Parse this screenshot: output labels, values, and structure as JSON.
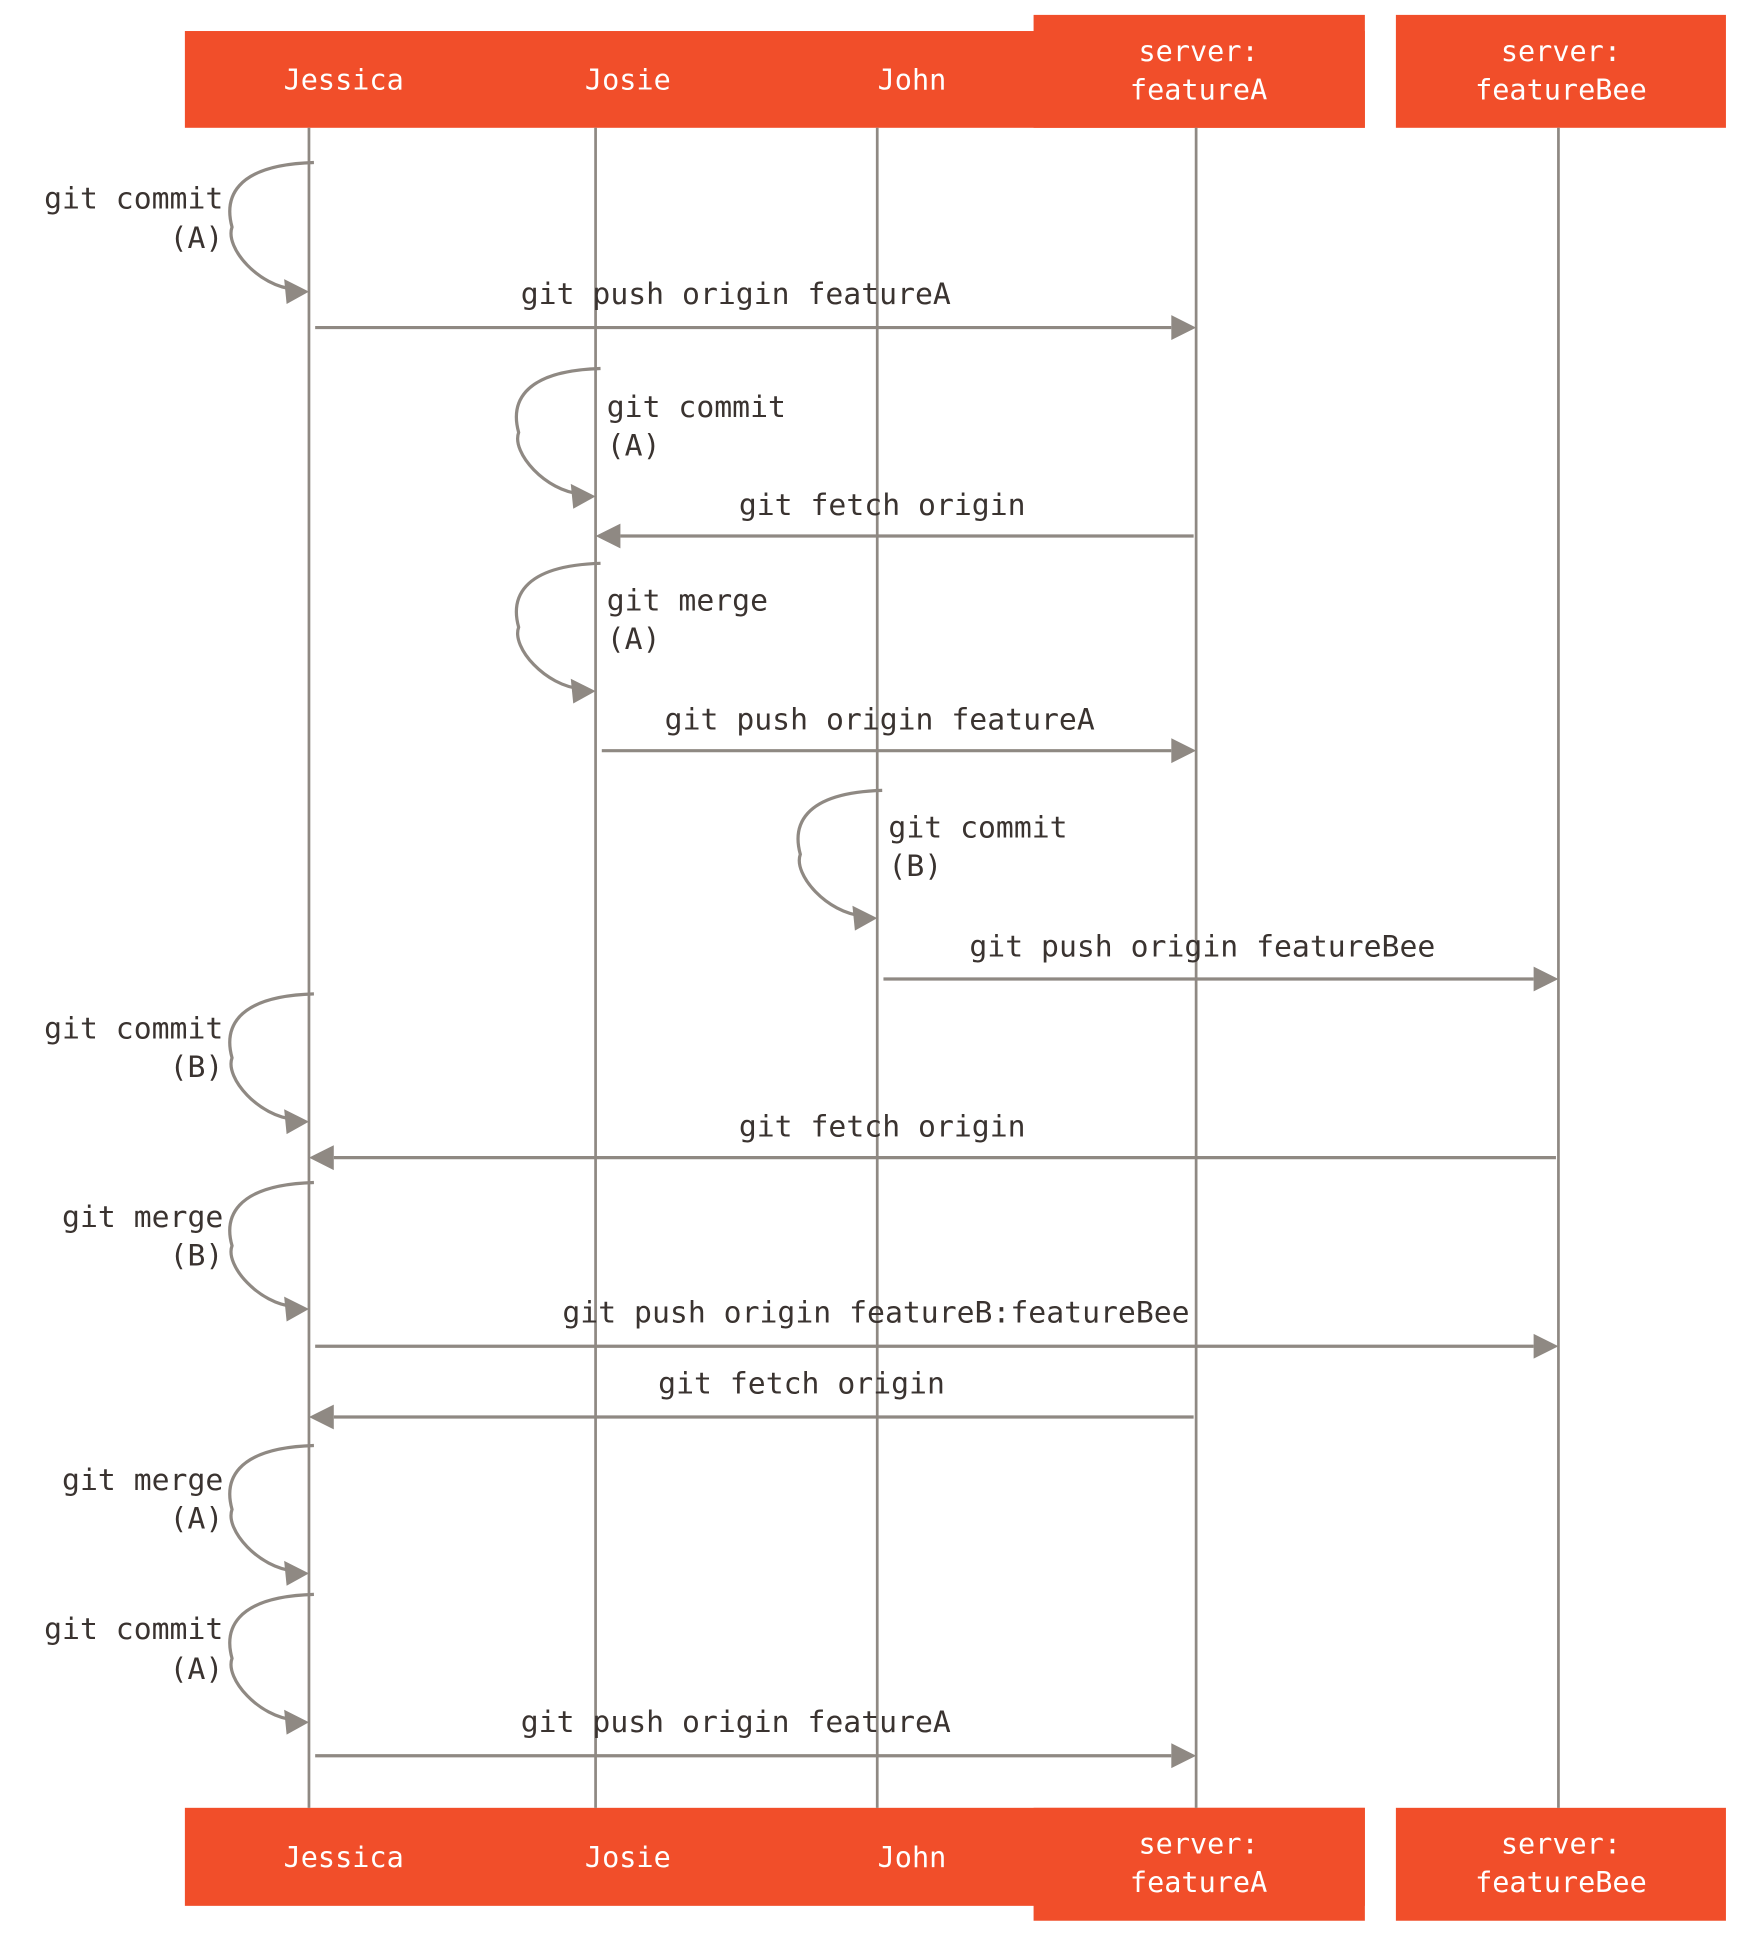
{
  "participants": [
    {
      "id": "jessica",
      "label": [
        "Jessica"
      ]
    },
    {
      "id": "josie",
      "label": [
        "Josie"
      ]
    },
    {
      "id": "john",
      "label": [
        "John"
      ]
    },
    {
      "id": "featureA",
      "label": [
        "server:",
        "featureA"
      ]
    },
    {
      "id": "featureBee",
      "label": [
        "server:",
        "featureBee"
      ]
    }
  ],
  "colors": {
    "accent": "#f14e2a",
    "line": "#8f8983",
    "text": "#3a3330"
  },
  "steps": [
    {
      "type": "self",
      "actor": "jessica",
      "label": [
        "git commit",
        "(A)"
      ]
    },
    {
      "type": "message",
      "from": "jessica",
      "to": "featureA",
      "label": "git push origin featureA"
    },
    {
      "type": "self",
      "actor": "josie",
      "label": [
        "git commit",
        "(A)"
      ]
    },
    {
      "type": "message",
      "from": "featureA",
      "to": "josie",
      "label": "git fetch origin"
    },
    {
      "type": "self",
      "actor": "josie",
      "label": [
        "git merge",
        "(A)"
      ]
    },
    {
      "type": "message",
      "from": "josie",
      "to": "featureA",
      "label": "git push origin featureA"
    },
    {
      "type": "self",
      "actor": "john",
      "label": [
        "git commit",
        "(B)"
      ]
    },
    {
      "type": "message",
      "from": "john",
      "to": "featureBee",
      "label": "git push origin featureBee"
    },
    {
      "type": "self",
      "actor": "jessica",
      "label": [
        "git commit",
        "(B)"
      ]
    },
    {
      "type": "message",
      "from": "featureBee",
      "to": "jessica",
      "label": "git fetch origin"
    },
    {
      "type": "self",
      "actor": "jessica",
      "label": [
        "git merge",
        "(B)"
      ]
    },
    {
      "type": "message",
      "from": "jessica",
      "to": "featureBee",
      "label": "git push origin featureB:featureBee"
    },
    {
      "type": "message",
      "from": "featureA",
      "to": "jessica",
      "label": "git fetch origin"
    },
    {
      "type": "self",
      "actor": "jessica",
      "label": [
        "git merge",
        "(A)"
      ]
    },
    {
      "type": "self",
      "actor": "jessica",
      "label": [
        "git commit",
        "(A)"
      ]
    },
    {
      "type": "message",
      "from": "jessica",
      "to": "featureA",
      "label": "git push origin featureA"
    }
  ]
}
